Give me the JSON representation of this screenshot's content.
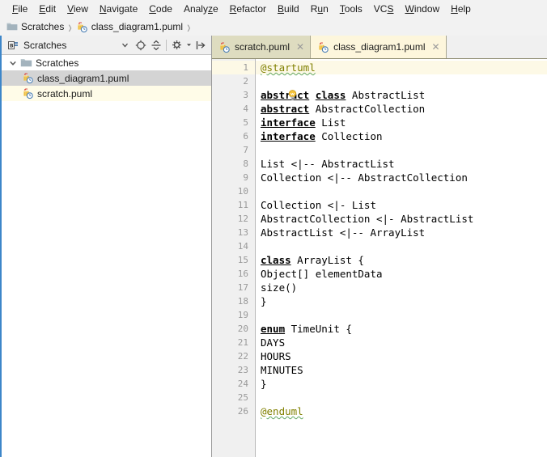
{
  "menu": {
    "items": [
      {
        "pre": "",
        "mn": "F",
        "post": "ile"
      },
      {
        "pre": "",
        "mn": "E",
        "post": "dit"
      },
      {
        "pre": "",
        "mn": "V",
        "post": "iew"
      },
      {
        "pre": "",
        "mn": "N",
        "post": "avigate"
      },
      {
        "pre": "",
        "mn": "C",
        "post": "ode"
      },
      {
        "pre": "Analy",
        "mn": "z",
        "post": "e"
      },
      {
        "pre": "",
        "mn": "R",
        "post": "efactor"
      },
      {
        "pre": "",
        "mn": "B",
        "post": "uild"
      },
      {
        "pre": "R",
        "mn": "u",
        "post": "n"
      },
      {
        "pre": "",
        "mn": "T",
        "post": "ools"
      },
      {
        "pre": "VC",
        "mn": "S",
        "post": ""
      },
      {
        "pre": "",
        "mn": "W",
        "post": "indow"
      },
      {
        "pre": "",
        "mn": "H",
        "post": "elp"
      }
    ]
  },
  "breadcrumb": {
    "items": [
      "Scratches",
      "class_diagram1.puml"
    ],
    "separator": "›"
  },
  "project_pane": {
    "title": "Scratches",
    "toolbar": [
      {
        "name": "chevron-down-icon",
        "label": "▾"
      },
      {
        "name": "locate-icon",
        "label": ""
      },
      {
        "name": "collapse-all-icon",
        "label": ""
      },
      {
        "name": "settings-gear-icon",
        "label": ""
      },
      {
        "name": "hide-panel-icon",
        "label": ""
      }
    ],
    "tree": [
      {
        "label": "Scratches",
        "icon": "folder-icon",
        "depth": 0,
        "expanded": true,
        "state": "normal"
      },
      {
        "label": "class_diagram1.puml",
        "icon": "puml-file-icon",
        "depth": 1,
        "expanded": null,
        "state": "selected"
      },
      {
        "label": "scratch.puml",
        "icon": "puml-file-icon",
        "depth": 1,
        "expanded": null,
        "state": "highlighted"
      }
    ]
  },
  "editor": {
    "tabs": [
      {
        "label": "scratch.puml",
        "icon": "puml-file-icon",
        "active": false,
        "close": "✕"
      },
      {
        "label": "class_diagram1.puml",
        "icon": "puml-file-icon",
        "active": true,
        "close": "✕"
      }
    ],
    "current_line": 1,
    "lines": [
      {
        "n": 1,
        "segments": [
          {
            "t": "@startuml",
            "c": "tagname"
          }
        ]
      },
      {
        "n": 2,
        "segments": [],
        "lightbulb": true
      },
      {
        "n": 3,
        "segments": [
          {
            "t": "abstract",
            "c": "kw"
          },
          {
            "t": " ",
            "c": ""
          },
          {
            "t": "class",
            "c": "kw"
          },
          {
            "t": " AbstractList",
            "c": ""
          }
        ]
      },
      {
        "n": 4,
        "segments": [
          {
            "t": "abstract",
            "c": "kw"
          },
          {
            "t": " AbstractCollection",
            "c": ""
          }
        ]
      },
      {
        "n": 5,
        "segments": [
          {
            "t": "interface",
            "c": "kw"
          },
          {
            "t": " List",
            "c": ""
          }
        ]
      },
      {
        "n": 6,
        "segments": [
          {
            "t": "interface",
            "c": "kw"
          },
          {
            "t": " Collection",
            "c": ""
          }
        ]
      },
      {
        "n": 7,
        "segments": []
      },
      {
        "n": 8,
        "segments": [
          {
            "t": "List <|-- AbstractList",
            "c": ""
          }
        ]
      },
      {
        "n": 9,
        "segments": [
          {
            "t": "Collection <|-- AbstractCollection",
            "c": ""
          }
        ]
      },
      {
        "n": 10,
        "segments": []
      },
      {
        "n": 11,
        "segments": [
          {
            "t": "Collection <|- List",
            "c": ""
          }
        ]
      },
      {
        "n": 12,
        "segments": [
          {
            "t": "AbstractCollection <|- AbstractList",
            "c": ""
          }
        ]
      },
      {
        "n": 13,
        "segments": [
          {
            "t": "AbstractList <|-- ArrayList",
            "c": ""
          }
        ]
      },
      {
        "n": 14,
        "segments": []
      },
      {
        "n": 15,
        "segments": [
          {
            "t": "class",
            "c": "kw"
          },
          {
            "t": " ArrayList {",
            "c": ""
          }
        ]
      },
      {
        "n": 16,
        "segments": [
          {
            "t": "Object[] elementData",
            "c": ""
          }
        ]
      },
      {
        "n": 17,
        "segments": [
          {
            "t": "size()",
            "c": ""
          }
        ]
      },
      {
        "n": 18,
        "segments": [
          {
            "t": "}",
            "c": ""
          }
        ]
      },
      {
        "n": 19,
        "segments": []
      },
      {
        "n": 20,
        "segments": [
          {
            "t": "enum",
            "c": "kw"
          },
          {
            "t": " TimeUnit {",
            "c": ""
          }
        ]
      },
      {
        "n": 21,
        "segments": [
          {
            "t": "DAYS",
            "c": ""
          }
        ]
      },
      {
        "n": 22,
        "segments": [
          {
            "t": "HOURS",
            "c": ""
          }
        ]
      },
      {
        "n": 23,
        "segments": [
          {
            "t": "MINUTES",
            "c": ""
          }
        ]
      },
      {
        "n": 24,
        "segments": [
          {
            "t": "}",
            "c": ""
          }
        ]
      },
      {
        "n": 25,
        "segments": []
      },
      {
        "n": 26,
        "segments": [
          {
            "t": "@enduml",
            "c": "tagname"
          }
        ]
      }
    ]
  },
  "colors": {
    "accent_blue": "#3d86c9",
    "tab_active": "#fdf6dc",
    "tab_inactive": "#dedcc0",
    "selection_gray": "#d4d4d4",
    "scratch_yellow": "#fffce8",
    "keyword": "#000000",
    "tag": "#808000",
    "current_line": "#fdf9e6"
  }
}
